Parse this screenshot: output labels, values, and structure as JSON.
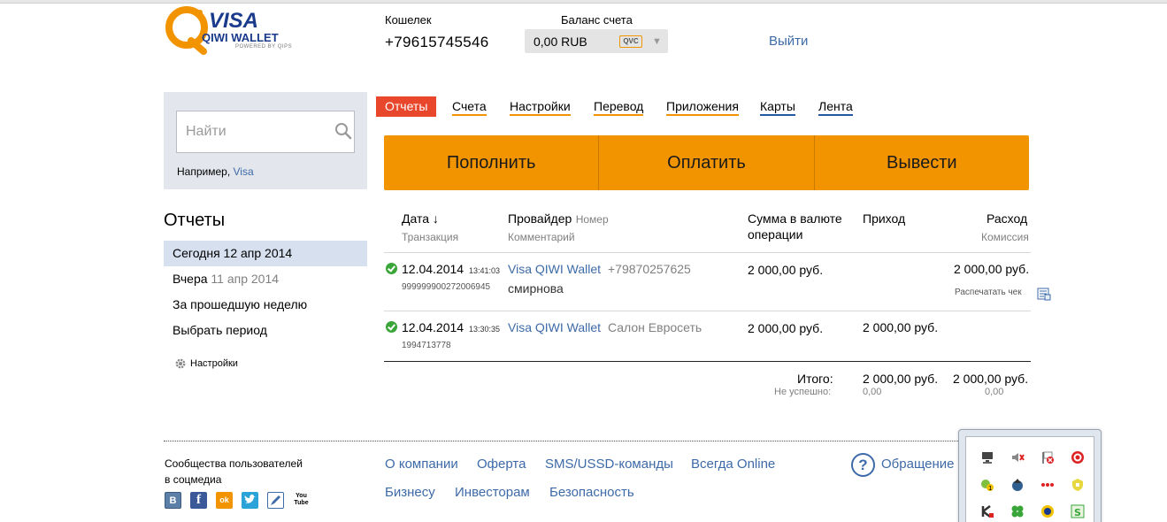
{
  "header": {
    "logo": {
      "brand": "VISA",
      "product": "QIWI WALLET",
      "powered": "POWERED BY QIPS"
    },
    "wallet_label": "Кошелек",
    "wallet_number": "+79615745546",
    "balance_label": "Баланс счета",
    "balance_value": "0,00 RUB",
    "currency_badge": "QVC",
    "logout_label": "Выйти"
  },
  "sidebar": {
    "search_placeholder": "Найти",
    "search_example_prefix": "Например, ",
    "search_example_link": "Visa",
    "reports_title": "Отчеты",
    "items": [
      {
        "label": "Сегодня 12 апр 2014",
        "muted": "",
        "active": true
      },
      {
        "label": "Вчера",
        "muted": "11 апр 2014",
        "active": false
      },
      {
        "label": "За прошедшую неделю",
        "muted": "",
        "active": false
      },
      {
        "label": "Выбрать период",
        "muted": "",
        "active": false
      }
    ],
    "settings_label": "Настройки"
  },
  "tabs": [
    {
      "label": "Отчеты",
      "active": true
    },
    {
      "label": "Счета"
    },
    {
      "label": "Настройки"
    },
    {
      "label": "Перевод"
    },
    {
      "label": "Приложения"
    },
    {
      "label": "Карты"
    },
    {
      "label": "Лента"
    }
  ],
  "actions": [
    "Пополнить",
    "Оплатить",
    "Вывести"
  ],
  "table": {
    "headers": {
      "date": "Дата ↓",
      "transaction": "Транзакция",
      "provider": "Провайдер",
      "number": "Номер",
      "comment": "Комментарий",
      "amount_line1": "Сумма в валюте",
      "amount_line2": "операции",
      "income": "Приход",
      "expense": "Расход",
      "commission": "Комиссия"
    },
    "rows": [
      {
        "date": "12.04.2014",
        "time": "13:41:03",
        "txn_id": "999999900272006945",
        "provider": "Visa QIWI Wallet",
        "number": "+79870257625",
        "comment": "смирнова",
        "amount": "2 000,00 руб.",
        "income": "",
        "expense": "2 000,00 руб.",
        "print_label": "Распечатать чек"
      },
      {
        "date": "12.04.2014",
        "time": "13:30:35",
        "txn_id": "1994713778",
        "provider": "Visa QIWI Wallet",
        "number": "Салон Евросеть",
        "comment": "",
        "amount": "2 000,00 руб.",
        "income": "2 000,00 руб.",
        "expense": ""
      }
    ],
    "total_label": "Итого:",
    "total_income": "2 000,00 руб.",
    "total_expense": "2 000,00 руб.",
    "failed_label": "Не успешно:",
    "failed_income": "0,00",
    "failed_expense": "0,00"
  },
  "footer": {
    "community_line1": "Сообщества пользователей",
    "community_line2": "в соцмедиа",
    "social": [
      "B",
      "f",
      "ok",
      "twitter",
      "lj",
      "You Tube"
    ],
    "links_row1": [
      "О компании",
      "Оферта",
      "SMS/USSD-команды",
      "Всегда Online"
    ],
    "links_row2": [
      "Бизнесу",
      "Инвесторам",
      "Безопасность"
    ],
    "help_label": "Обращение в"
  },
  "colors": {
    "accent_orange": "#f29400",
    "active_tab_red": "#e8472c",
    "link_blue": "#3d6aa8"
  }
}
